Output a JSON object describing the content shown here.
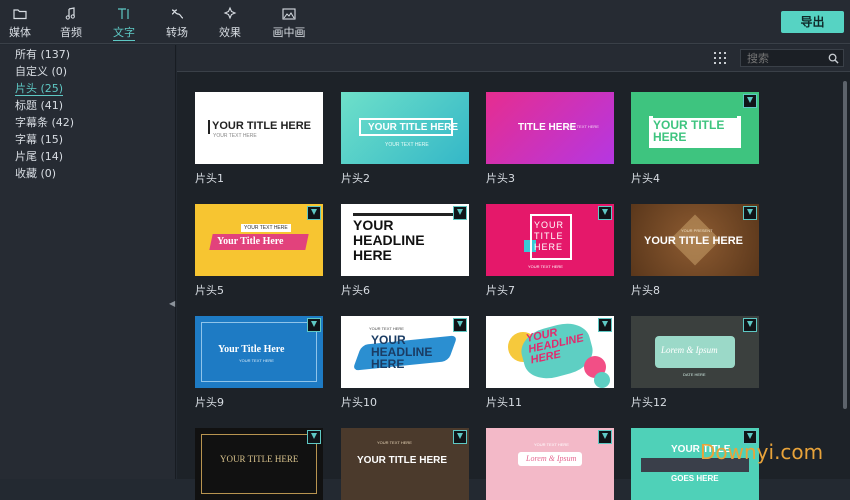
{
  "toolbar": {
    "tabs": [
      {
        "label": "媒体",
        "icon": "folder-icon"
      },
      {
        "label": "音频",
        "icon": "music-note-icon"
      },
      {
        "label": "文字",
        "icon": "text-icon"
      },
      {
        "label": "转场",
        "icon": "transition-icon"
      },
      {
        "label": "效果",
        "icon": "effects-icon"
      },
      {
        "label": "画中画",
        "icon": "picture-in-picture-icon"
      }
    ],
    "active_tab": "文字",
    "export_label": "导出"
  },
  "sidebar": {
    "categories": [
      {
        "label": "所有 (137)"
      },
      {
        "label": "自定义 (0)"
      },
      {
        "label": "片头 (25)",
        "active": true
      },
      {
        "label": "标题 (41)"
      },
      {
        "label": "字幕条 (42)"
      },
      {
        "label": "字幕 (15)"
      },
      {
        "label": "片尾 (14)"
      },
      {
        "label": "收藏 (0)"
      }
    ]
  },
  "search": {
    "placeholder": "搜索"
  },
  "colors": {
    "accent": "#5ec8c4",
    "export_bg": "#56d3c3"
  },
  "grid": {
    "items": [
      {
        "caption": "片头1",
        "text": "YOUR TITLE HERE",
        "sub": "YOUR TEXT HERE"
      },
      {
        "caption": "片头2",
        "text": "YOUR TITLE HERE",
        "sub": "YOUR TEXT HERE"
      },
      {
        "caption": "片头3",
        "text": "TITLE HERE",
        "sub": "YOUR TEXT HERE"
      },
      {
        "caption": "片头4",
        "text": "YOUR TITLE HERE"
      },
      {
        "caption": "片头5",
        "text": "Your Title Here",
        "sub": "YOUR TEXT HERE"
      },
      {
        "caption": "片头6",
        "text": "YOUR HEADLINE HERE"
      },
      {
        "caption": "片头7",
        "text": "YOUR TITLE HERE",
        "sub": "YOUR TEXT HERE"
      },
      {
        "caption": "片头8",
        "text": "YOUR TITLE HERE",
        "sub": "YOUR PRESENT"
      },
      {
        "caption": "片头9",
        "text": "Your Title Here",
        "sub": "YOUR TEXT HERE"
      },
      {
        "caption": "片头10",
        "text": "YOUR HEADLINE HERE",
        "sub": "YOUR TEXT HERE"
      },
      {
        "caption": "片头11",
        "text": "YOUR HEADLINE HERE"
      },
      {
        "caption": "片头12",
        "text": "Lorem & Ipsum",
        "sub": "DATE HERE"
      },
      {
        "caption": "",
        "text": "YOUR TITLE HERE"
      },
      {
        "caption": "",
        "text": "YOUR TITLE HERE",
        "sub": "YOUR TEXT HERE"
      },
      {
        "caption": "",
        "text": "Lorem & Ipsum",
        "sub": "YOUR TEXT HERE"
      },
      {
        "caption": "",
        "text": "YOUR TITLE",
        "sub": "GOES HERE"
      }
    ]
  },
  "watermark": "Downyi.com"
}
